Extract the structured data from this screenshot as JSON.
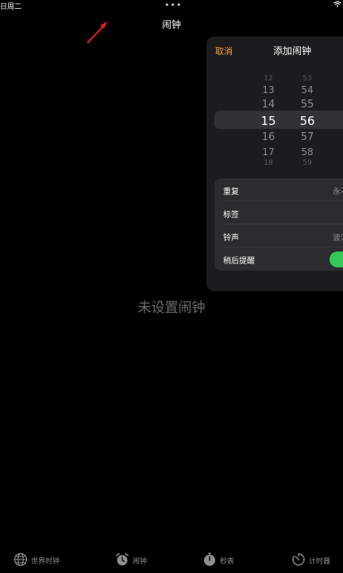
{
  "status": {
    "date": "日周二",
    "dots": "•••"
  },
  "header": {
    "title": "闹钟"
  },
  "main": {
    "empty_text": "未设置闹钟"
  },
  "sheet": {
    "cancel_label": "取消",
    "title": "添加闹钟",
    "picker": {
      "hours": [
        "12",
        "13",
        "14",
        "15",
        "16",
        "17",
        "18"
      ],
      "minutes": [
        "53",
        "54",
        "55",
        "56",
        "57",
        "58",
        "59"
      ],
      "selected_hour": "15",
      "selected_minute": "56"
    },
    "settings": [
      {
        "label": "重复",
        "value": "永不"
      },
      {
        "label": "标签",
        "value": ""
      },
      {
        "label": "铃声",
        "value": "波浪"
      },
      {
        "label": "稍后提醒",
        "toggle": true
      }
    ]
  },
  "tabs": [
    {
      "label": "世界时钟",
      "icon": "globe-icon"
    },
    {
      "label": "闹钟",
      "icon": "alarm-clock-icon"
    },
    {
      "label": "秒表",
      "icon": "stopwatch-icon"
    },
    {
      "label": "计时器",
      "icon": "timer-icon"
    }
  ],
  "colors": {
    "accent": "#f0a03a",
    "toggle_on": "#34c759",
    "annotation": "#e0241b"
  }
}
